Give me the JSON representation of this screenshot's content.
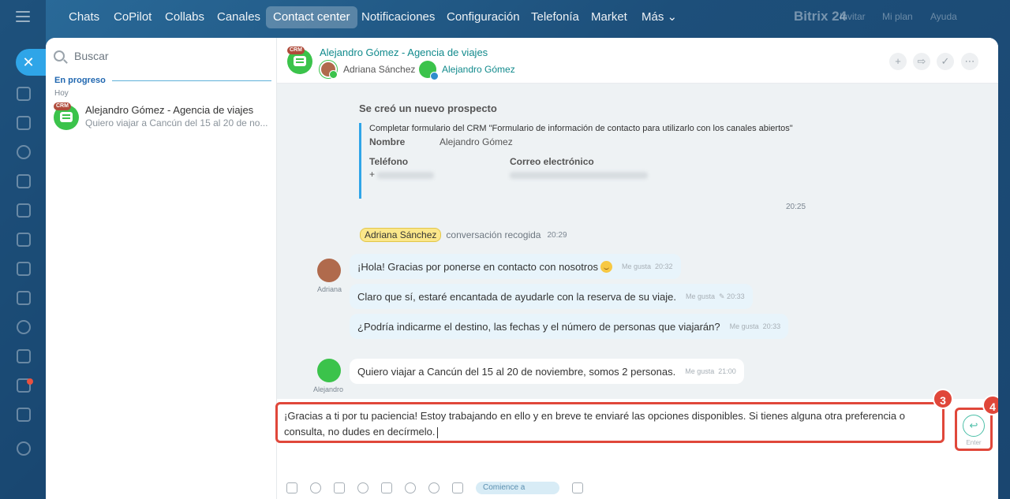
{
  "nav": {
    "items": [
      "Chats",
      "CoPilot",
      "Collabs",
      "Canales",
      "Contact center",
      "Notificaciones",
      "Configuración",
      "Telefonía",
      "Market",
      "Más ⌄"
    ],
    "active": "Contact center",
    "logo": "Bitrix 24",
    "faded_links": [
      "Invitar",
      "Mi plan",
      "Ayuda"
    ]
  },
  "sidebar": {
    "search_placeholder": "Buscar",
    "group_title": "En progreso",
    "group_subtitle": "Hoy",
    "chats": [
      {
        "title": "Alejandro Gómez - Agencia de viajes",
        "preview": "Quiero viajar a Cancún del 15 al 20 de no...",
        "tag": "CRM"
      }
    ]
  },
  "header": {
    "title": "Alejandro Gómez - Agencia de viajes",
    "tag": "CRM",
    "operator": "Adriana Sánchez",
    "client": "Alejandro Gómez",
    "actions": [
      "add",
      "forward",
      "check",
      "more"
    ]
  },
  "system": {
    "title": "Se creó un nuevo prospecto",
    "form": "Completar formulario del CRM \"Formulario de información de contacto para utilizarlo con los canales abiertos\"",
    "name_label": "Nombre",
    "name_value": "Alejandro Gómez",
    "phone_label": "Teléfono",
    "phone_value": "+",
    "email_label": "Correo electrónico",
    "time": "20:25"
  },
  "pickup": {
    "name": "Adriana Sánchez",
    "text": "conversación recogida",
    "time": "20:29"
  },
  "messages": [
    {
      "author": "Adriana",
      "text": "¡Hola! Gracias por ponerse en contacto con nosotros",
      "like": "Me gusta",
      "time": "20:32"
    },
    {
      "author": "Adriana",
      "text": "Claro que sí, estaré encantada de ayudarle con la reserva de su viaje.",
      "like": "Me gusta",
      "time": "✎ 20:33"
    },
    {
      "author": "Adriana",
      "text": "¿Podría indicarme el destino, las fechas y el número de personas que viajarán?",
      "like": "Me gusta",
      "time": "20:33"
    },
    {
      "author": "Alejandro",
      "text": "Quiero viajar a Cancún del 15 al 20 de noviembre, somos 2 personas.",
      "like": "Me gusta",
      "time": "21:00"
    }
  ],
  "composer": {
    "text": "¡Gracias a ti por tu paciencia! Estoy trabajando en ello y en breve te enviaré las opciones disponibles. Si tienes alguna otra preferencia o consulta, no dudes en decírmelo.",
    "step_input": "3",
    "step_send": "4",
    "send_label": "Enter",
    "chip": "Comience a",
    "accent": "#e0473a"
  },
  "colors": {
    "brand": "#2fa5e8",
    "crm_green": "#3bc34b",
    "highlight": "#e0473a"
  }
}
